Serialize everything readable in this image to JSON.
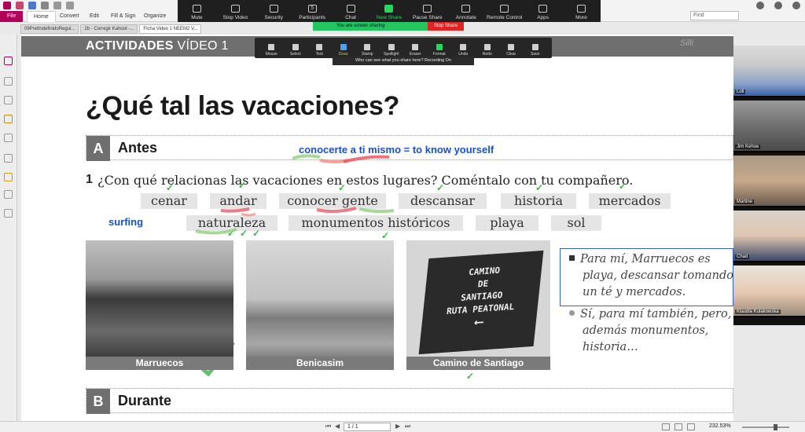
{
  "ribbon": {
    "tabs": [
      "File",
      "Home",
      "Convert",
      "Edit",
      "Fill & Sign",
      "Organize"
    ],
    "find_placeholder": "Find",
    "colors": {
      "file_tab": "#b0005a"
    }
  },
  "zoom_toolbar": {
    "items": [
      {
        "label": "Mute",
        "icon": "microphone-icon"
      },
      {
        "label": "Stop Video",
        "icon": "camera-icon"
      },
      {
        "label": "Security",
        "icon": "shield-icon"
      },
      {
        "label": "Participants",
        "icon": "people-icon",
        "count": "5"
      },
      {
        "label": "Chat",
        "icon": "chat-icon"
      },
      {
        "label": "New Share",
        "icon": "share-screen-icon"
      },
      {
        "label": "Pause Share",
        "icon": "pause-icon"
      },
      {
        "label": "Annotate",
        "icon": "pencil-icon"
      },
      {
        "label": "Remote Control",
        "icon": "mouse-icon"
      },
      {
        "label": "Apps",
        "icon": "apps-icon"
      },
      {
        "label": "More",
        "icon": "ellipsis-icon"
      }
    ],
    "sharing_text": "You are screen sharing",
    "stop_share": "Stop Share"
  },
  "doc_tabs": [
    "09PretIndefinidoRegul...",
    "2b - Corregir Kahoot -...",
    "Ficha Video 1 NEEM2 V..."
  ],
  "annotate_toolbar": {
    "items": [
      "Mouse",
      "Select",
      "Text",
      "Draw",
      "Stamp",
      "Spotlight",
      "Eraser",
      "Format",
      "Undo",
      "Redo",
      "Clear",
      "Save"
    ],
    "selected": "Draw",
    "note": "Who can see what you share here? Recording On"
  },
  "page": {
    "header_bold": "ACTIVIDADES",
    "header_light": "VÍDEO 1",
    "bg_text": "Silli",
    "title": "¿Qué tal las vacaciones?",
    "section_a": {
      "letter": "A",
      "name": "Antes"
    },
    "section_b": {
      "letter": "B",
      "name": "Durante"
    },
    "handwritten_note": "conocerte a ti mismo = to know yourself",
    "question_number": "1",
    "question": "¿Con qué relacionas las vacaciones en estos lugares? Coméntalo con tu compañero.",
    "words_row1": [
      "cenar",
      "andar",
      "conocer gente",
      "descansar",
      "historia",
      "mercados"
    ],
    "words_row2": [
      "naturaleza",
      "monumentos históricos",
      "playa",
      "sol"
    ],
    "surfing_note": "surfing",
    "photos": [
      "Marruecos",
      "Benicasim",
      "Camino de Santiago"
    ],
    "sign_text": [
      "CAMINO",
      "DE",
      "SANTIAGO",
      "RUTA PEATONAL"
    ],
    "dialogue": [
      "Para mí, Marruecos es",
      "playa, descansar tomando",
      "un té y mercados.",
      "Sí, para mí también, pero,",
      "además monumentos,",
      "historia…"
    ]
  },
  "participants": [
    {
      "name": "Loli"
    },
    {
      "name": "Jim Kehoe"
    },
    {
      "name": "Martine"
    },
    {
      "name": "Chad"
    },
    {
      "name": "Klaudia Kulakowska"
    }
  ],
  "status": {
    "page_indicator": "1 / 1",
    "zoom": "232.53%"
  }
}
